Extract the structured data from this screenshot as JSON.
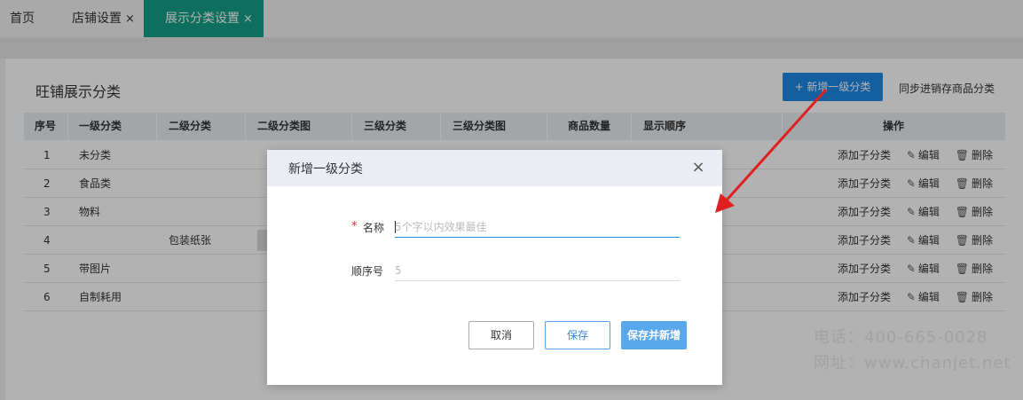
{
  "tabs": [
    {
      "label": "首页"
    },
    {
      "label": "店铺设置",
      "close": "×"
    },
    {
      "label": "展示分类设置",
      "close": "×"
    }
  ],
  "page": {
    "title": "旺铺展示分类",
    "add_button": "+ 新增一级分类",
    "sync_button": "同步进销存商品分类"
  },
  "table": {
    "headers": {
      "no": "序号",
      "level1": "一级分类",
      "level2": "二级分类",
      "level2_img": "二级分类图",
      "level3": "三级分类",
      "level3_img": "三级分类图",
      "count": "商品数量",
      "order": "显示顺序",
      "ops": "操作"
    },
    "rows": [
      {
        "no": "1",
        "level1": "未分类",
        "level2": ""
      },
      {
        "no": "2",
        "level1": "食品类",
        "level2": ""
      },
      {
        "no": "3",
        "level1": "物料",
        "level2": ""
      },
      {
        "no": "4",
        "level1": "",
        "level2": "包装纸张"
      },
      {
        "no": "5",
        "level1": "带图片",
        "level2": ""
      },
      {
        "no": "6",
        "level1": "自制耗用",
        "level2": ""
      }
    ],
    "op_labels": {
      "add_child": "添加子分类",
      "edit": "编辑",
      "delete": "删除"
    }
  },
  "watermark": {
    "line1": "电话：400-665-0028",
    "line2": "网址：www.chanjet.net"
  },
  "modal": {
    "title": "新增一级分类",
    "close": "×",
    "required_mark": "*",
    "name_label": "名称",
    "name_placeholder": "5个字以内效果最佳",
    "order_label": "顺序号",
    "order_placeholder": "5",
    "cancel": "取消",
    "save": "保存",
    "save_new": "保存并新增"
  },
  "colors": {
    "tab_active": "#15a087",
    "primary": "#1e88e5",
    "required": "#e0292b",
    "annotation_arrow": "#e02020"
  },
  "icons": {
    "edit": "edit-icon",
    "delete": "trash-icon",
    "close": "close-icon"
  }
}
